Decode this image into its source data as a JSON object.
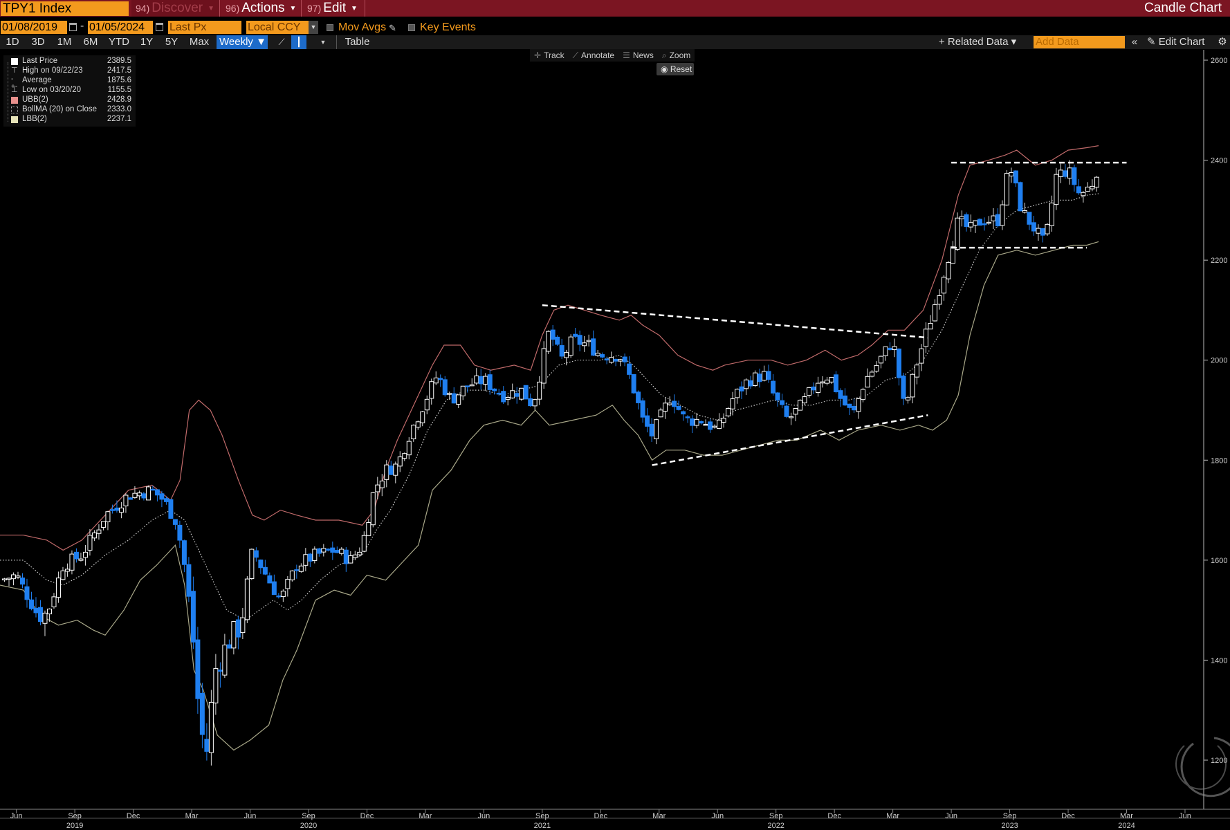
{
  "topbar": {
    "ticker": "TPY1 Index",
    "discover_num": "94)",
    "discover_label": "Discover",
    "actions_num": "96)",
    "actions_label": "Actions",
    "edit_num": "97)",
    "edit_label": "Edit",
    "title": "Candle Chart"
  },
  "params": {
    "start_date": "01/08/2019",
    "separator": "-",
    "end_date": "01/05/2024",
    "price_field": "Last Px",
    "currency": "Local CCY",
    "mov_avgs": "Mov Avgs",
    "key_events": "Key Events"
  },
  "toolbar": {
    "periods": [
      "1D",
      "3D",
      "1M",
      "6M",
      "YTD",
      "1Y",
      "5Y",
      "Max"
    ],
    "frequency": "Weekly ▼",
    "table": "Table",
    "related": "+ Related Data ▾",
    "add_data_placeholder": "Add Data",
    "edit_chart": "Edit Chart"
  },
  "chart_tools": {
    "track": "Track",
    "annotate": "Annotate",
    "news": "News",
    "zoom": "Zoom",
    "reset": "Reset"
  },
  "legend": [
    {
      "label": "Last Price",
      "value": "2389.5",
      "color": "#ffffff"
    },
    {
      "label": "High on 09/22/23",
      "value": "2417.5",
      "color": "#bbbbbb"
    },
    {
      "label": "Average",
      "value": "1875.6",
      "color": "#bbbbbb"
    },
    {
      "label": "Low on 03/20/20",
      "value": "1155.5",
      "color": "#bbbbbb"
    },
    {
      "label": "UBB(2)",
      "value": "2428.9",
      "color": "#e8908c"
    },
    {
      "label": "BollMA (20)  on Close",
      "value": "2333.0",
      "color": "#cccccc"
    },
    {
      "label": "LBB(2)",
      "value": "2237.1",
      "color": "#e6e3b8"
    }
  ],
  "colors": {
    "up_candle": "#ffffff",
    "down_candle": "#1f7ff0",
    "ubb": "#c06a6a",
    "lbb": "#a9a889",
    "bollma": "#cccccc",
    "trendline": "#ffffff"
  },
  "chart_data": {
    "type": "candlestick",
    "title": "",
    "y_ticks": [
      1200,
      1400,
      1600,
      1800,
      2000,
      2200,
      2400,
      2600
    ],
    "ylim": [
      1100,
      2620
    ],
    "x_ticks": [
      {
        "label": "Jun",
        "date": 2019.42
      },
      {
        "label": "Sep",
        "date": 2019.67
      },
      {
        "label": "Dec",
        "date": 2019.92
      },
      {
        "label": "Mar",
        "date": 2020.17
      },
      {
        "label": "Jun",
        "date": 2020.42
      },
      {
        "label": "Sep",
        "date": 2020.67
      },
      {
        "label": "Dec",
        "date": 2020.92
      },
      {
        "label": "Mar",
        "date": 2021.17
      },
      {
        "label": "Jun",
        "date": 2021.42
      },
      {
        "label": "Sep",
        "date": 2021.67
      },
      {
        "label": "Dec",
        "date": 2021.92
      },
      {
        "label": "Mar",
        "date": 2022.17
      },
      {
        "label": "Jun",
        "date": 2022.42
      },
      {
        "label": "Sep",
        "date": 2022.67
      },
      {
        "label": "Dec",
        "date": 2022.92
      },
      {
        "label": "Mar",
        "date": 2023.17
      },
      {
        "label": "Jun",
        "date": 2023.42
      },
      {
        "label": "Sep",
        "date": 2023.67
      },
      {
        "label": "Dec",
        "date": 2023.92
      },
      {
        "label": "Mar",
        "date": 2024.17
      },
      {
        "label": "Jun",
        "date": 2024.42
      }
    ],
    "year_labels": [
      {
        "label": "2019",
        "date": 2019.67
      },
      {
        "label": "2020",
        "date": 2020.67
      },
      {
        "label": "2021",
        "date": 2021.67
      },
      {
        "label": "2022",
        "date": 2022.67
      },
      {
        "label": "2023",
        "date": 2023.67
      },
      {
        "label": "2024",
        "date": 2024.17
      }
    ],
    "xlim": [
      2019.35,
      2024.5
    ],
    "close_path": [
      [
        2019.35,
        1560
      ],
      [
        2019.42,
        1570
      ],
      [
        2019.5,
        1500
      ],
      [
        2019.55,
        1490
      ],
      [
        2019.62,
        1590
      ],
      [
        2019.7,
        1610
      ],
      [
        2019.8,
        1690
      ],
      [
        2019.9,
        1730
      ],
      [
        2020.0,
        1740
      ],
      [
        2020.05,
        1720
      ],
      [
        2020.1,
        1680
      ],
      [
        2020.13,
        1620
      ],
      [
        2020.17,
        1480
      ],
      [
        2020.2,
        1300
      ],
      [
        2020.23,
        1200
      ],
      [
        2020.27,
        1380
      ],
      [
        2020.33,
        1440
      ],
      [
        2020.38,
        1470
      ],
      [
        2020.43,
        1620
      ],
      [
        2020.5,
        1560
      ],
      [
        2020.55,
        1520
      ],
      [
        2020.62,
        1590
      ],
      [
        2020.7,
        1610
      ],
      [
        2020.78,
        1620
      ],
      [
        2020.85,
        1600
      ],
      [
        2020.9,
        1630
      ],
      [
        2020.95,
        1740
      ],
      [
        2021.0,
        1780
      ],
      [
        2021.05,
        1790
      ],
      [
        2021.1,
        1850
      ],
      [
        2021.17,
        1920
      ],
      [
        2021.22,
        1970
      ],
      [
        2021.28,
        1920
      ],
      [
        2021.35,
        1950
      ],
      [
        2021.42,
        1960
      ],
      [
        2021.5,
        1930
      ],
      [
        2021.58,
        1940
      ],
      [
        2021.63,
        1910
      ],
      [
        2021.7,
        2060
      ],
      [
        2021.75,
        2000
      ],
      [
        2021.8,
        2040
      ],
      [
        2021.87,
        2030
      ],
      [
        2021.92,
        2010
      ],
      [
        2022.0,
        2010
      ],
      [
        2022.05,
        1960
      ],
      [
        2022.1,
        1880
      ],
      [
        2022.14,
        1850
      ],
      [
        2022.17,
        1880
      ],
      [
        2022.22,
        1930
      ],
      [
        2022.28,
        1880
      ],
      [
        2022.35,
        1880
      ],
      [
        2022.42,
        1860
      ],
      [
        2022.48,
        1920
      ],
      [
        2022.55,
        1960
      ],
      [
        2022.62,
        1970
      ],
      [
        2022.67,
        1920
      ],
      [
        2022.72,
        1880
      ],
      [
        2022.78,
        1910
      ],
      [
        2022.85,
        1960
      ],
      [
        2022.9,
        1970
      ],
      [
        2022.95,
        1920
      ],
      [
        2023.0,
        1890
      ],
      [
        2023.05,
        1960
      ],
      [
        2023.1,
        1990
      ],
      [
        2023.17,
        2040
      ],
      [
        2023.22,
        1900
      ],
      [
        2023.27,
        1990
      ],
      [
        2023.33,
        2080
      ],
      [
        2023.38,
        2160
      ],
      [
        2023.45,
        2280
      ],
      [
        2023.5,
        2260
      ],
      [
        2023.55,
        2280
      ],
      [
        2023.62,
        2280
      ],
      [
        2023.67,
        2390
      ],
      [
        2023.72,
        2300
      ],
      [
        2023.78,
        2260
      ],
      [
        2023.82,
        2230
      ],
      [
        2023.87,
        2370
      ],
      [
        2023.92,
        2380
      ],
      [
        2023.97,
        2330
      ],
      [
        2024.02,
        2350
      ],
      [
        2024.05,
        2389.5
      ]
    ],
    "ubb_path": [
      [
        2019.35,
        1650
      ],
      [
        2019.45,
        1650
      ],
      [
        2019.55,
        1640
      ],
      [
        2019.62,
        1620
      ],
      [
        2019.7,
        1640
      ],
      [
        2019.8,
        1690
      ],
      [
        2019.9,
        1740
      ],
      [
        2020.0,
        1750
      ],
      [
        2020.08,
        1720
      ],
      [
        2020.12,
        1760
      ],
      [
        2020.16,
        1900
      ],
      [
        2020.2,
        1920
      ],
      [
        2020.25,
        1900
      ],
      [
        2020.3,
        1850
      ],
      [
        2020.37,
        1760
      ],
      [
        2020.43,
        1690
      ],
      [
        2020.48,
        1680
      ],
      [
        2020.55,
        1700
      ],
      [
        2020.62,
        1690
      ],
      [
        2020.7,
        1680
      ],
      [
        2020.8,
        1680
      ],
      [
        2020.9,
        1670
      ],
      [
        2020.95,
        1700
      ],
      [
        2021.0,
        1780
      ],
      [
        2021.05,
        1840
      ],
      [
        2021.12,
        1910
      ],
      [
        2021.2,
        1990
      ],
      [
        2021.25,
        2030
      ],
      [
        2021.32,
        2030
      ],
      [
        2021.38,
        1990
      ],
      [
        2021.45,
        1980
      ],
      [
        2021.55,
        1990
      ],
      [
        2021.62,
        1980
      ],
      [
        2021.67,
        2050
      ],
      [
        2021.72,
        2100
      ],
      [
        2021.78,
        2110
      ],
      [
        2021.85,
        2100
      ],
      [
        2021.92,
        2090
      ],
      [
        2022.0,
        2080
      ],
      [
        2022.05,
        2090
      ],
      [
        2022.1,
        2070
      ],
      [
        2022.17,
        2050
      ],
      [
        2022.25,
        2010
      ],
      [
        2022.33,
        1990
      ],
      [
        2022.4,
        1980
      ],
      [
        2022.45,
        1990
      ],
      [
        2022.55,
        2000
      ],
      [
        2022.65,
        2000
      ],
      [
        2022.72,
        1990
      ],
      [
        2022.8,
        2000
      ],
      [
        2022.88,
        2020
      ],
      [
        2022.95,
        2000
      ],
      [
        2023.02,
        2010
      ],
      [
        2023.08,
        2030
      ],
      [
        2023.15,
        2060
      ],
      [
        2023.22,
        2060
      ],
      [
        2023.3,
        2100
      ],
      [
        2023.38,
        2200
      ],
      [
        2023.45,
        2330
      ],
      [
        2023.5,
        2390
      ],
      [
        2023.58,
        2400
      ],
      [
        2023.65,
        2410
      ],
      [
        2023.7,
        2420
      ],
      [
        2023.78,
        2390
      ],
      [
        2023.85,
        2400
      ],
      [
        2023.92,
        2420
      ],
      [
        2024.0,
        2425
      ],
      [
        2024.05,
        2429
      ]
    ],
    "bollma_path": [
      [
        2019.35,
        1600
      ],
      [
        2019.45,
        1600
      ],
      [
        2019.55,
        1560
      ],
      [
        2019.62,
        1550
      ],
      [
        2019.7,
        1570
      ],
      [
        2019.8,
        1610
      ],
      [
        2019.9,
        1640
      ],
      [
        2020.0,
        1680
      ],
      [
        2020.08,
        1700
      ],
      [
        2020.14,
        1680
      ],
      [
        2020.2,
        1620
      ],
      [
        2020.26,
        1560
      ],
      [
        2020.32,
        1500
      ],
      [
        2020.4,
        1480
      ],
      [
        2020.46,
        1500
      ],
      [
        2020.52,
        1520
      ],
      [
        2020.58,
        1500
      ],
      [
        2020.64,
        1520
      ],
      [
        2020.72,
        1560
      ],
      [
        2020.8,
        1590
      ],
      [
        2020.9,
        1610
      ],
      [
        2020.96,
        1660
      ],
      [
        2021.02,
        1700
      ],
      [
        2021.1,
        1770
      ],
      [
        2021.18,
        1860
      ],
      [
        2021.26,
        1920
      ],
      [
        2021.34,
        1940
      ],
      [
        2021.42,
        1940
      ],
      [
        2021.5,
        1930
      ],
      [
        2021.58,
        1940
      ],
      [
        2021.66,
        1950
      ],
      [
        2021.74,
        1990
      ],
      [
        2021.82,
        2000
      ],
      [
        2021.92,
        2000
      ],
      [
        2022.0,
        2010
      ],
      [
        2022.06,
        1990
      ],
      [
        2022.12,
        1960
      ],
      [
        2022.18,
        1930
      ],
      [
        2022.26,
        1910
      ],
      [
        2022.34,
        1890
      ],
      [
        2022.42,
        1880
      ],
      [
        2022.5,
        1900
      ],
      [
        2022.58,
        1910
      ],
      [
        2022.66,
        1920
      ],
      [
        2022.74,
        1910
      ],
      [
        2022.82,
        1910
      ],
      [
        2022.9,
        1920
      ],
      [
        2022.98,
        1920
      ],
      [
        2023.06,
        1930
      ],
      [
        2023.14,
        1960
      ],
      [
        2023.22,
        1970
      ],
      [
        2023.3,
        2000
      ],
      [
        2023.38,
        2060
      ],
      [
        2023.46,
        2140
      ],
      [
        2023.54,
        2220
      ],
      [
        2023.62,
        2270
      ],
      [
        2023.7,
        2300
      ],
      [
        2023.78,
        2310
      ],
      [
        2023.86,
        2320
      ],
      [
        2023.94,
        2320
      ],
      [
        2024.0,
        2330
      ],
      [
        2024.05,
        2333
      ]
    ],
    "lbb_path": [
      [
        2019.35,
        1550
      ],
      [
        2019.45,
        1540
      ],
      [
        2019.52,
        1490
      ],
      [
        2019.6,
        1470
      ],
      [
        2019.68,
        1480
      ],
      [
        2019.75,
        1460
      ],
      [
        2019.8,
        1450
      ],
      [
        2019.88,
        1500
      ],
      [
        2019.95,
        1560
      ],
      [
        2020.02,
        1590
      ],
      [
        2020.1,
        1630
      ],
      [
        2020.14,
        1550
      ],
      [
        2020.18,
        1380
      ],
      [
        2020.22,
        1340
      ],
      [
        2020.28,
        1250
      ],
      [
        2020.35,
        1220
      ],
      [
        2020.42,
        1240
      ],
      [
        2020.5,
        1270
      ],
      [
        2020.56,
        1360
      ],
      [
        2020.62,
        1420
      ],
      [
        2020.7,
        1520
      ],
      [
        2020.78,
        1540
      ],
      [
        2020.85,
        1530
      ],
      [
        2020.92,
        1570
      ],
      [
        2021.0,
        1560
      ],
      [
        2021.08,
        1600
      ],
      [
        2021.14,
        1630
      ],
      [
        2021.2,
        1740
      ],
      [
        2021.28,
        1780
      ],
      [
        2021.36,
        1840
      ],
      [
        2021.42,
        1870
      ],
      [
        2021.5,
        1880
      ],
      [
        2021.58,
        1870
      ],
      [
        2021.64,
        1900
      ],
      [
        2021.7,
        1870
      ],
      [
        2021.8,
        1880
      ],
      [
        2021.9,
        1890
      ],
      [
        2021.97,
        1910
      ],
      [
        2022.02,
        1880
      ],
      [
        2022.08,
        1850
      ],
      [
        2022.14,
        1800
      ],
      [
        2022.2,
        1820
      ],
      [
        2022.28,
        1820
      ],
      [
        2022.36,
        1810
      ],
      [
        2022.44,
        1810
      ],
      [
        2022.52,
        1820
      ],
      [
        2022.6,
        1830
      ],
      [
        2022.68,
        1840
      ],
      [
        2022.76,
        1840
      ],
      [
        2022.86,
        1860
      ],
      [
        2022.94,
        1840
      ],
      [
        2023.02,
        1860
      ],
      [
        2023.12,
        1870
      ],
      [
        2023.2,
        1860
      ],
      [
        2023.28,
        1870
      ],
      [
        2023.34,
        1860
      ],
      [
        2023.4,
        1880
      ],
      [
        2023.45,
        1930
      ],
      [
        2023.5,
        2050
      ],
      [
        2023.56,
        2150
      ],
      [
        2023.62,
        2210
      ],
      [
        2023.7,
        2220
      ],
      [
        2023.78,
        2210
      ],
      [
        2023.86,
        2220
      ],
      [
        2023.94,
        2230
      ],
      [
        2024.0,
        2230
      ],
      [
        2024.05,
        2237
      ]
    ],
    "trendlines": [
      {
        "from": [
          2021.67,
          2110
        ],
        "to": [
          2023.32,
          2045
        ]
      },
      {
        "from": [
          2022.14,
          1790
        ],
        "to": [
          2023.32,
          1890
        ]
      },
      {
        "from": [
          2023.42,
          2395
        ],
        "to": [
          2024.17,
          2395
        ]
      },
      {
        "from": [
          2023.42,
          2225
        ],
        "to": [
          2024.0,
          2225
        ]
      }
    ]
  }
}
